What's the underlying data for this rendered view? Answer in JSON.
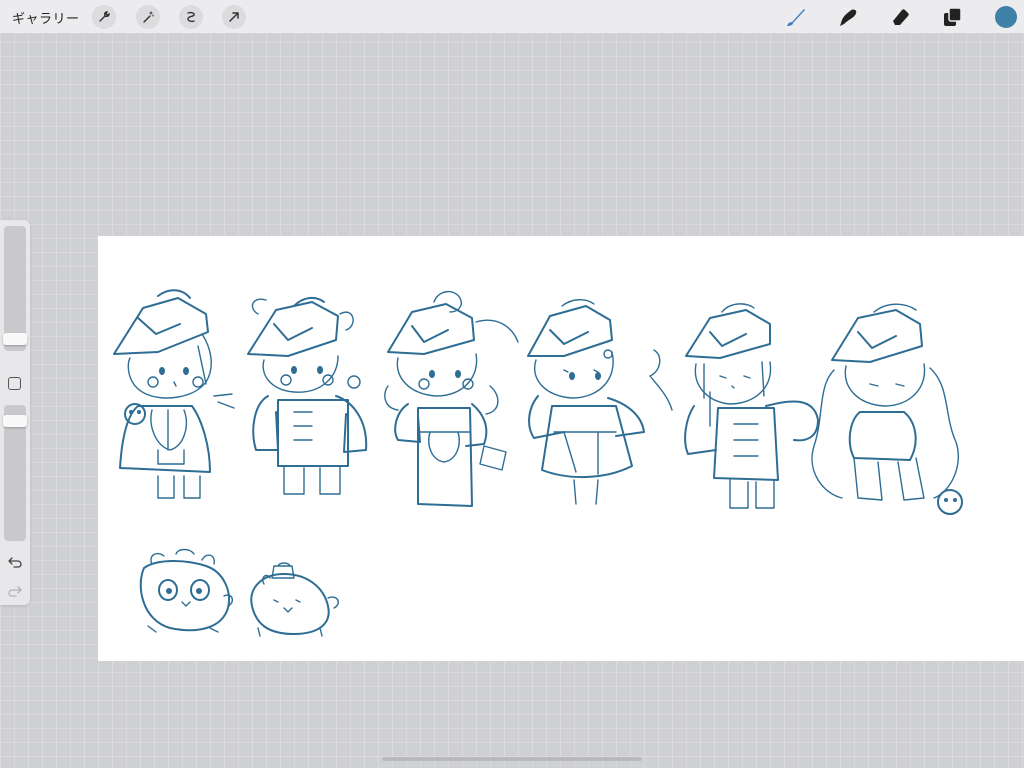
{
  "toolbar": {
    "gallery_label": "ギャラリー",
    "left_tools": [
      "wrench-icon",
      "magic-wand-icon",
      "selection-icon",
      "transform-arrow-icon"
    ],
    "right_tools": [
      "brush-icon",
      "smudge-icon",
      "eraser-icon",
      "layers-icon"
    ],
    "active_tool": "brush-icon",
    "current_color": "#3f82a8"
  },
  "sidebar": {
    "controls": [
      "brush-size-slider",
      "modify-button",
      "opacity-slider",
      "undo-icon",
      "redo-icon"
    ]
  },
  "canvas": {
    "background": "#ffffff",
    "stroke_color": "#2e6d94"
  }
}
